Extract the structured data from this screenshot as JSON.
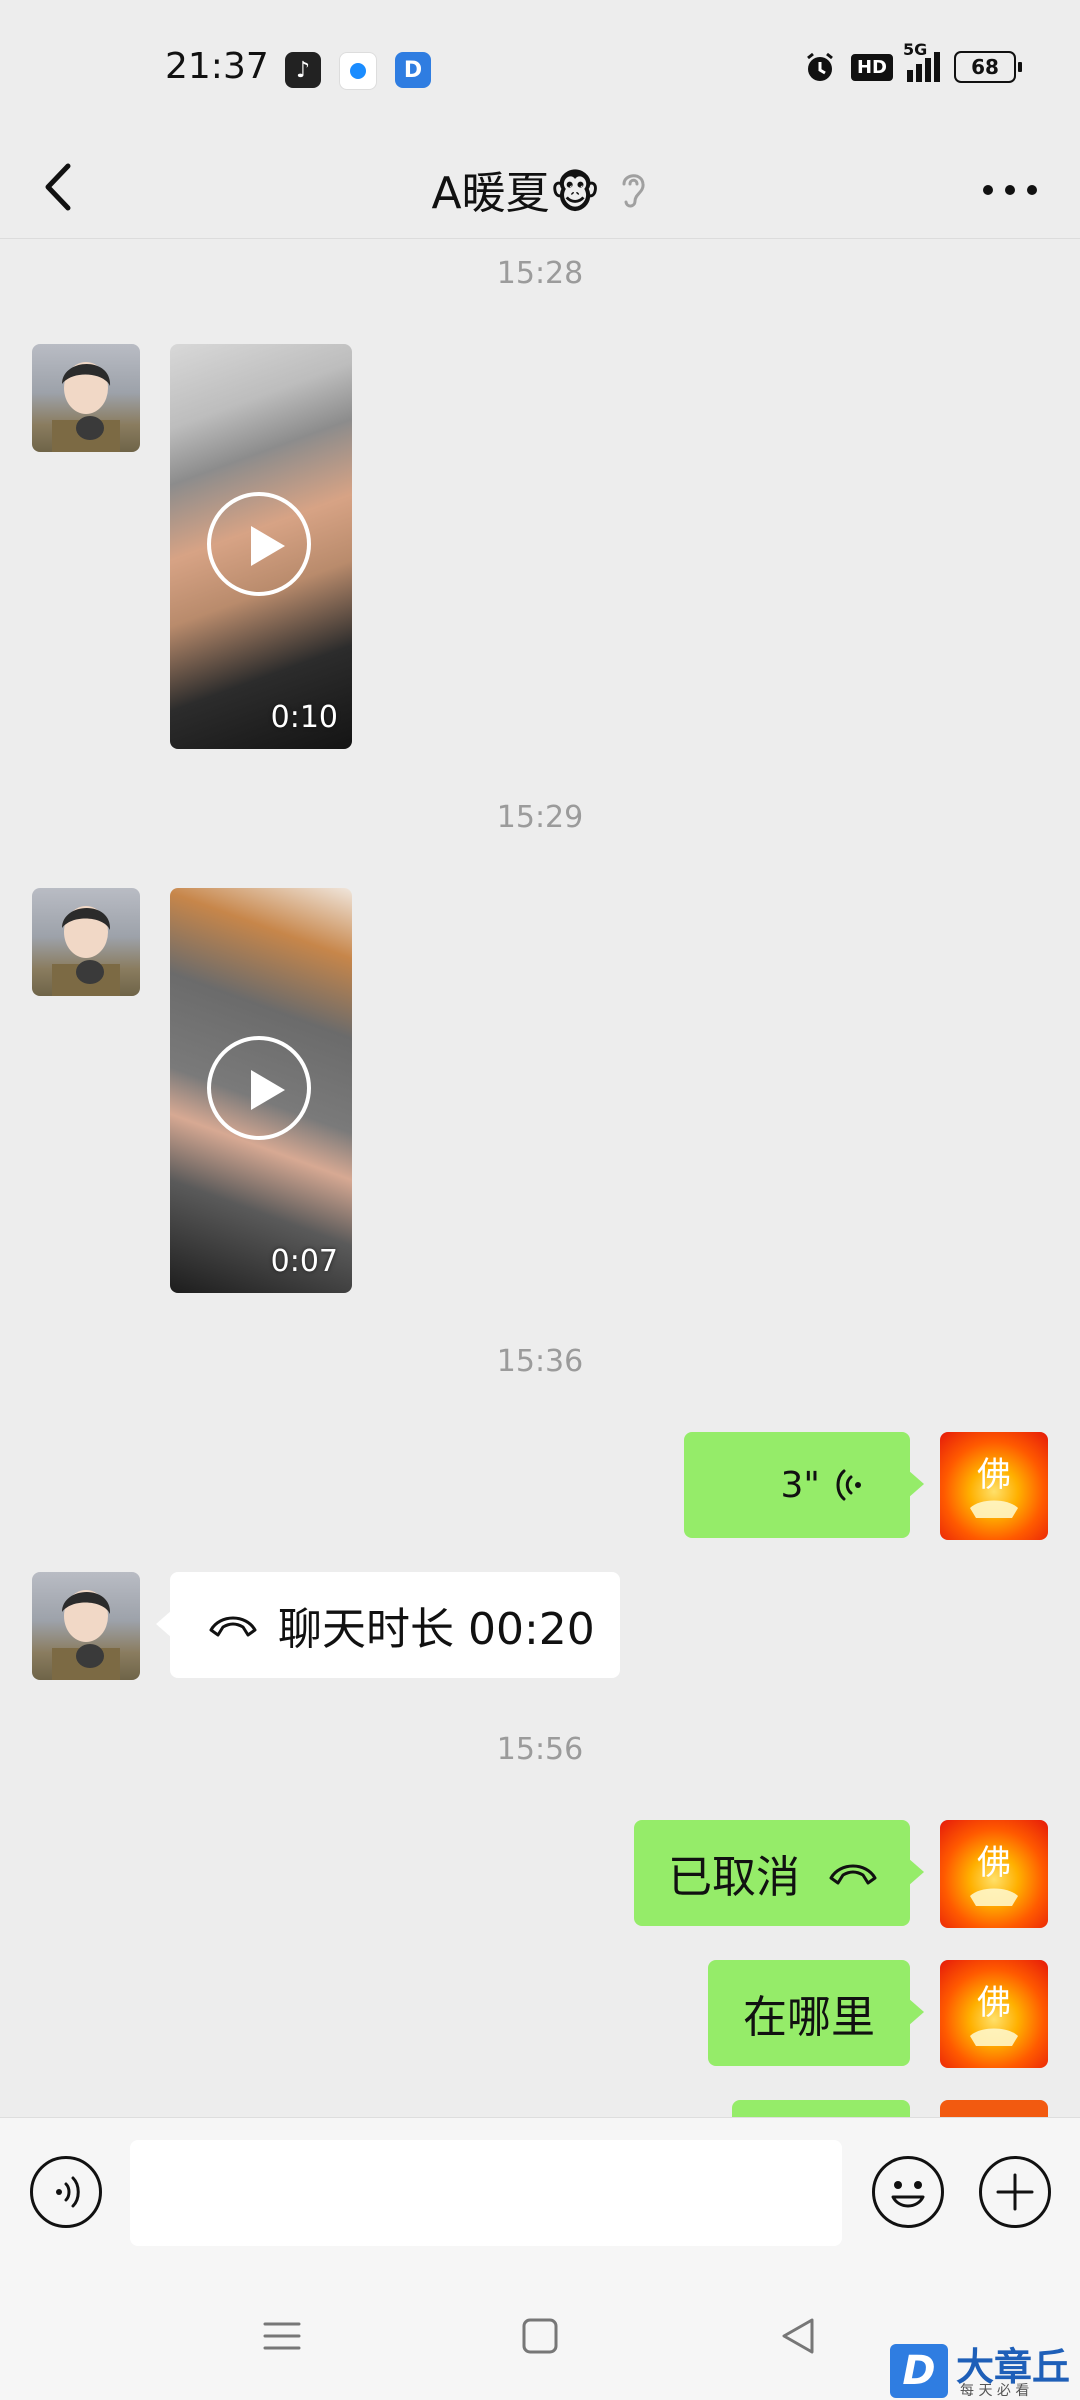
{
  "status_bar": {
    "time": "21:37",
    "network": "5G",
    "hd": "HD",
    "battery": "68"
  },
  "header": {
    "title": "A暖夏🐵",
    "icons": [
      "back-arrow-icon",
      "ear-icon",
      "more-icon"
    ]
  },
  "chat": {
    "timestamps": [
      "15:28",
      "15:29",
      "15:36",
      "15:56"
    ],
    "videos": [
      {
        "duration": "0:10"
      },
      {
        "duration": "0:07"
      }
    ],
    "voice": {
      "duration": "3\""
    },
    "call_received": {
      "text": "聊天时长 00:20"
    },
    "call_cancelled": {
      "text": "已取消"
    },
    "text_message": {
      "text": "在哪里"
    }
  },
  "watermark": {
    "brand": "大章丘",
    "slogan": "每 天 必 看"
  },
  "colors": {
    "sent_bubble": "#95ec69",
    "background": "#ededed",
    "received_bubble": "#ffffff"
  }
}
